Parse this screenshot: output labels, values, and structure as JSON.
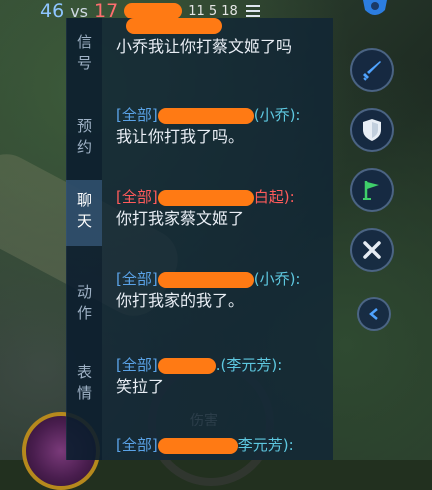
{
  "score": {
    "blue": "46",
    "vs": "vs",
    "red": "17",
    "extra": "11  5  18"
  },
  "tabs": [
    {
      "label": "信号",
      "active": false
    },
    {
      "label": "预约",
      "active": false
    },
    {
      "label": "聊天",
      "active": true
    },
    {
      "label": "动作",
      "active": false
    },
    {
      "label": "表情",
      "active": false
    }
  ],
  "messages": [
    {
      "channel": "",
      "role": "",
      "text": "小乔我让你打蔡文姬了吗"
    },
    {
      "channel": "[全部]",
      "role": "(小乔):",
      "text": "我让你打我了吗。"
    },
    {
      "channel": "[全部]",
      "role": "白起):",
      "text": "你打我家蔡文姬了"
    },
    {
      "channel": "[全部]",
      "role": "(小乔):",
      "text": "你打我家的我了。"
    },
    {
      "channel": "[全部]",
      "role": ".(李元芳):",
      "text": "笑拉了"
    },
    {
      "channel": "[全部]",
      "role": "李元芳):",
      "text": ""
    }
  ],
  "background_label": "伤害",
  "colors": {
    "blot": "#ff7a14",
    "channel_blue": "#5aa2e6",
    "channel_red": "#ff5b5b"
  }
}
